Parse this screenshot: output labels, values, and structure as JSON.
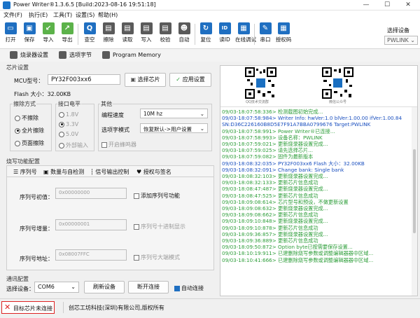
{
  "window": {
    "title": "Power Writer®1.3.6.5 [Build:2023-08-16 19:51:18]",
    "minimize": "—",
    "maximize": "☐",
    "close": "✕"
  },
  "menu": [
    "文件(F)",
    "执行(E)",
    "工具(T)",
    "设置(S)",
    "帮助(H)"
  ],
  "toolbar": {
    "items": [
      {
        "label": "打开",
        "glyph": "▭"
      },
      {
        "label": "保存",
        "glyph": "▣"
      },
      {
        "label": "导入",
        "glyph": "↙"
      },
      {
        "label": "导出",
        "glyph": "↗"
      },
      {
        "label": "查空",
        "glyph": "Q"
      },
      {
        "label": "擦除",
        "glyph": "▤"
      },
      {
        "label": "读取",
        "glyph": "▤"
      },
      {
        "label": "写入",
        "glyph": "▤"
      },
      {
        "label": "校验",
        "glyph": "▤"
      },
      {
        "label": "自动",
        "glyph": "☻"
      },
      {
        "label": "复位",
        "glyph": "↻"
      },
      {
        "label": "读ID",
        "glyph": "ID"
      },
      {
        "label": "在线调试",
        "glyph": "▦"
      },
      {
        "label": "串口",
        "glyph": "✎"
      },
      {
        "label": "授权码",
        "glyph": "▦"
      }
    ],
    "device_label": "选择设备",
    "device_value": "PWLINK"
  },
  "subtoolbar": {
    "writer_settings": "烧录器设置",
    "options_bytes": "选项字节",
    "program_memory": "Program Memory"
  },
  "chip": {
    "section": "芯片设置",
    "mcu_label": "MCU型号：",
    "mcu_value": "PY32F003xx6",
    "select_chip": "选择芯片",
    "apply": "应用设置",
    "flash_size": "Flash 大小：32.00KB"
  },
  "erase": {
    "title": "擦除方式",
    "options": [
      "不擦除",
      "全片擦除",
      "页面擦除"
    ],
    "selected": 1
  },
  "voltage": {
    "title": "接口电平",
    "options": [
      "1.8V",
      "3.3V",
      "5.0V",
      "外部输入"
    ],
    "selected": 1
  },
  "other": {
    "title": "其他",
    "speed_label": "编程速度",
    "speed_value": "10M hz",
    "opt_label": "选项字模式",
    "opt_value": "恢复默认->用户设置",
    "buzzer": "开启蜂鸣器"
  },
  "serial": {
    "section": "烧写功能配置",
    "tabs": [
      "序列号",
      "数量与自检测",
      "信号输出控制",
      "授权与签名"
    ],
    "addr_label": "序列号初值：",
    "addr_value": "0x00000000",
    "enable": "添加序列号功能",
    "step_label": "序列号增量：",
    "step_value": "0x00000001",
    "hex_opt": "序列号十进制显示",
    "store_label": "序列号地址：",
    "store_value": "0x08007FFC",
    "big_endian": "序列号大端模式"
  },
  "comm": {
    "section": "通讯配置",
    "port_label": "选择设备：",
    "port_value": "COM6",
    "refresh": "刷新设备",
    "disconnect": "断开连接",
    "auto": "自动连接"
  },
  "qr": {
    "left_caption": "QQ技术交流群",
    "right_caption": "微信公众号"
  },
  "log": [
    {
      "t": "09/03-18:07:58:336> 检测截图初始完成...",
      "c": "#2e9e3a"
    },
    {
      "t": "09/03-18:07:58:984> Writer Info: hwVer:1.0  blVer:1.00.00  ifVer:1.00.84",
      "c": "#1a4fbf"
    },
    {
      "t": "SN:D36C226160B8D5E7F91A7BBA0799676 Target:PWLINK",
      "c": "#1a4fbf"
    },
    {
      "t": "09/03-18:07:58:991> Power Writer®已连接...",
      "c": "#2e9e3a"
    },
    {
      "t": "09/03-18:07:58:993> 设备名称：PWLINK",
      "c": "#2e9e3a"
    },
    {
      "t": "09/03-18:07:59:021> 更新烧录器设置完成...",
      "c": "#2e9e3a"
    },
    {
      "t": "09/03-18:07:59:025> 请先选择芯片...",
      "c": "#2e9e3a"
    },
    {
      "t": "09/03-18:07:59:082> 固件为最新版本",
      "c": "#2e9e3a"
    },
    {
      "t": "09/03-18:08:32:035> PY32F003xx6 Flash 大小：32.00KB",
      "c": "#1a4fbf"
    },
    {
      "t": "09/03-18:08:32:091> Change bank: Single bank",
      "c": "#1a4fbf"
    },
    {
      "t": "09/03-18:08:32:103> 更新烧录器设置完成...",
      "c": "#2e9e3a"
    },
    {
      "t": "09/03-18:08:32:133> 更新芯片信息成功",
      "c": "#2e9e3a"
    },
    {
      "t": "09/03-18:08:47:487> 更新烧录器设置完成...",
      "c": "#2e9e3a"
    },
    {
      "t": "09/03-18:08:47:525> 更新芯片信息成功",
      "c": "#2e9e3a"
    },
    {
      "t": "09/03-18:09:08:614> 芯片型号和预设，不做更新设置",
      "c": "#2e9e3a"
    },
    {
      "t": "09/03-18:09:08:632> 更新烧录器设置完成...",
      "c": "#2e9e3a"
    },
    {
      "t": "09/03-18:09:08:662> 更新芯片信息成功",
      "c": "#2e9e3a"
    },
    {
      "t": "09/03-18:09:10:848> 更新烧录器设置完成...",
      "c": "#2e9e3a"
    },
    {
      "t": "09/03-18:09:10:878> 更新芯片信息成功",
      "c": "#2e9e3a"
    },
    {
      "t": "09/03-18:09:36:857> 更新烧录器设置完成...",
      "c": "#2e9e3a"
    },
    {
      "t": "09/03-18:09:36:889> 更新芯片信息成功",
      "c": "#2e9e3a"
    },
    {
      "t": "09/03-18:09:50:872> Option byte已按需要保存设置...",
      "c": "#2e9e3a"
    },
    {
      "t": "09/03-18:10:19:911> 已建删除烧写参数或调整编辑器器中区域...",
      "c": "#2e9e3a"
    },
    {
      "t": "09/03-18:10:41:666> 已建删除烧写参数或调整编辑器器中区域...",
      "c": "#2e9e3a"
    }
  ],
  "status": {
    "chip_state": "目标芯片未连接",
    "copyright": "创芯工坊科技(深圳)有限公司,版权所有"
  }
}
